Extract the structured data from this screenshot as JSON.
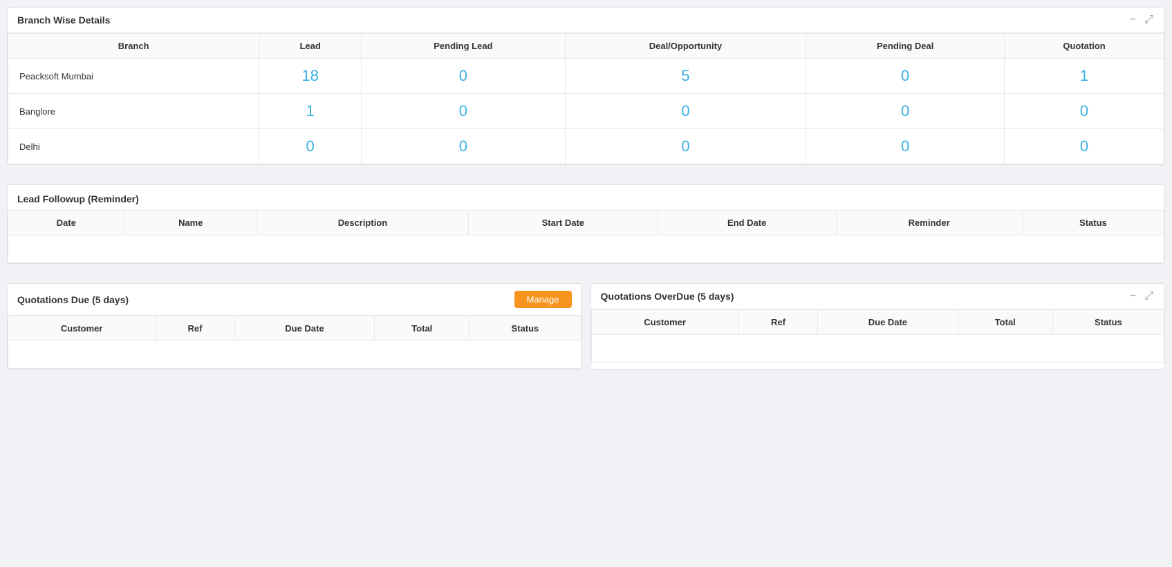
{
  "branchWise": {
    "title": "Branch Wise Details",
    "columns": [
      "Branch",
      "Lead",
      "Pending Lead",
      "Deal/Opportunity",
      "Pending Deal",
      "Quotation"
    ],
    "rows": [
      {
        "branch": "Peacksoft Mumbai",
        "lead": "18",
        "pendingLead": "0",
        "deal": "5",
        "pendingDeal": "0",
        "quotation": "1"
      },
      {
        "branch": "Banglore",
        "lead": "1",
        "pendingLead": "0",
        "deal": "0",
        "pendingDeal": "0",
        "quotation": "0"
      },
      {
        "branch": "Delhi",
        "lead": "0",
        "pendingLead": "0",
        "deal": "0",
        "pendingDeal": "0",
        "quotation": "0"
      }
    ],
    "controls": {
      "minimize": "−",
      "expand": "⤢"
    }
  },
  "leadFollowup": {
    "title": "Lead Followup (Reminder)",
    "columns": [
      "Date",
      "Name",
      "Description",
      "Start Date",
      "End Date",
      "Reminder",
      "Status"
    ]
  },
  "quotationsDue": {
    "title": "Quotations Due (5 days)",
    "manageBtn": "Manage",
    "columns": [
      "Customer",
      "Ref",
      "Due Date",
      "Total",
      "Status"
    ]
  },
  "quotationsOverdue": {
    "title": "Quotations OverDue (5 days)",
    "columns": [
      "Customer",
      "Ref",
      "Due Date",
      "Total",
      "Status"
    ],
    "controls": {
      "minimize": "−",
      "expand": "⤢"
    }
  }
}
